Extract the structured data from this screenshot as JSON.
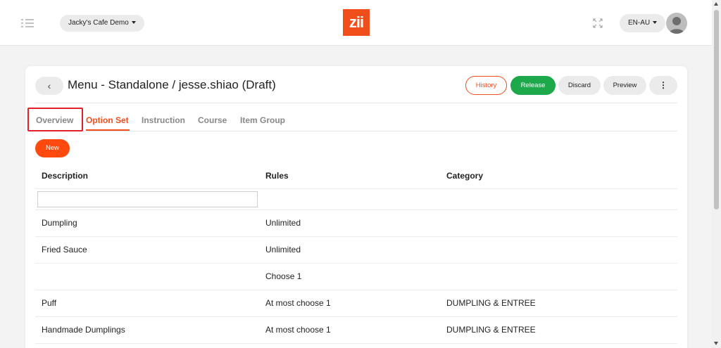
{
  "topbar": {
    "store": "Jacky's Cafe Demo",
    "logo": "zii",
    "language": "EN-AU"
  },
  "header": {
    "back": "‹",
    "title": "Menu - Standalone / jesse.shiao (Draft)",
    "buttons": {
      "history": "History",
      "release": "Release",
      "discard": "Discard",
      "preview": "Preview",
      "more": "⋮"
    }
  },
  "tabs": [
    {
      "label": "Overview"
    },
    {
      "label": "Option Set"
    },
    {
      "label": "Instruction"
    },
    {
      "label": "Course"
    },
    {
      "label": "Item Group"
    }
  ],
  "active_tab": "Option Set",
  "new_button": "New",
  "table": {
    "columns": [
      "Description",
      "Rules",
      "Category"
    ],
    "filter_value": "",
    "rows": [
      {
        "description": "Dumpling",
        "rules": "Unlimited",
        "category": ""
      },
      {
        "description": "Fried Sauce",
        "rules": "Unlimited",
        "category": ""
      },
      {
        "description": "",
        "rules": "Choose 1",
        "category": ""
      },
      {
        "description": "Puff",
        "rules": "At most choose 1",
        "category": "DUMPLING & ENTREE"
      },
      {
        "description": "Handmade Dumplings",
        "rules": "At most choose 1",
        "category": "DUMPLING & ENTREE"
      }
    ]
  },
  "colors": {
    "brand": "#f04e1b",
    "release": "#1da84b",
    "highlight": "#e0202a"
  },
  "icons": {
    "menu": "list-menu-icon",
    "expand": "fullscreen-icon",
    "avatar": "user-avatar-icon"
  }
}
